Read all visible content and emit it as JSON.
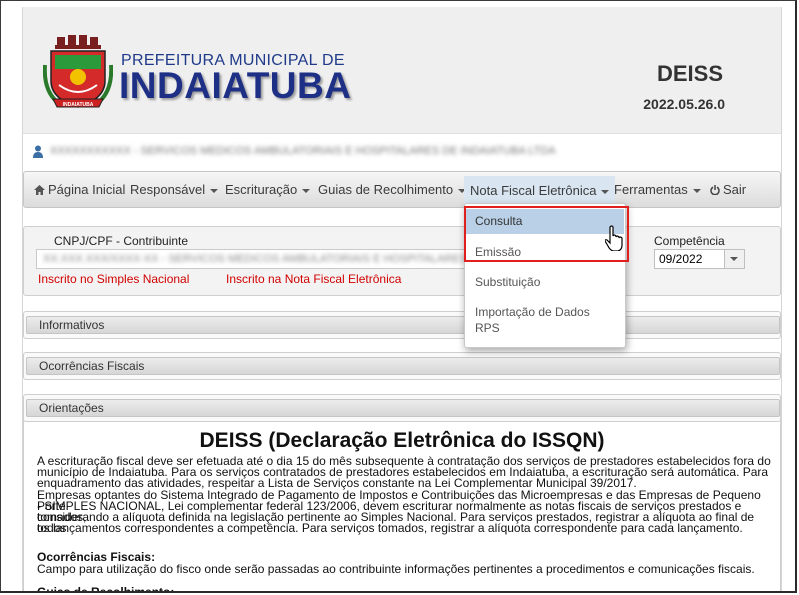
{
  "header": {
    "org_subtitle": "PREFEITURA MUNICIPAL DE",
    "org_name": "INDAIATUBA",
    "app_name": "DEISS",
    "app_version": "2022.05.26.0",
    "user_label": "XXXXXXXXXXX - SERVICOS MEDICOS AMBULATORIAIS E HOSPITALARES DE INDAIATUBA LTDA"
  },
  "nav": {
    "home": "Página Inicial",
    "responsavel": "Responsável",
    "escrituracao": "Escrituração",
    "guias": "Guias de Recolhimento",
    "nfe": "Nota Fiscal Eletrônica",
    "ferramentas": "Ferramentas",
    "sair": "Sair"
  },
  "dropdown": {
    "items": [
      "Consulta",
      "Emissão",
      "Substituição",
      "Importação de Dados",
      "RPS"
    ]
  },
  "contribuinte": {
    "label": "CNPJ/CPF - Contribuinte",
    "value": "XX.XXX.XXX/XXXX-XX - SERVICOS MEDICOS AMBULATORIAIS E HOSPITALARES",
    "simples": "Inscrito no Simples Nacional",
    "nfe": "Inscrito na Nota Fiscal Eletrônica",
    "competencia_label": "Competência",
    "competencia_value": "09/2022"
  },
  "sections": {
    "informativos": "Informativos",
    "ocorrencias": "Ocorrências Fiscais",
    "orientacoes": "Orientações"
  },
  "orientacoes": {
    "title": "DEISS (Declaração Eletrônica do ISSQN)",
    "p1_l1": "A escrituração fiscal deve ser efetuada até o dia 15 do mês subsequente à contratação dos serviços de prestadores estabelecidos fora do",
    "p1_l2": "município de Indaiatuba. Para os serviços contratados de prestadores estabelecidos em Indaiatuba, a escrituração será automática. Para",
    "p1_l3": "enquadramento das atividades, respeitar a Lista de Serviços constante na Lei Complementar Municipal 39/2017.",
    "p2_l1": "Empresas optantes do Sistema Integrado de Pagamento de Impostos e Contribuições das Microempresas e das Empresas de Pequeno Porte",
    "p2_l2": "- SIMPLES NACIONAL, Lei complementar federal 123/2006, devem escriturar normalmente as notas fiscais de serviços prestados e tomados,",
    "p2_l3": "considerando a alíquota definida na legislação pertinente ao Simples Nacional. Para serviços prestados, registrar a alíquota ao final de todos",
    "p2_l4": "os lançamentos correspondentes a competência. Para serviços tomados, registrar a alíquota correspondente para cada lançamento.",
    "ocorrencias_heading": "Ocorrências Fiscais:",
    "ocorrencias_text": "Campo para utilização do fisco onde serão passadas ao contribuinte informações pertinentes a procedimentos e comunicações fiscais.",
    "guias_heading": "Guias de Recolhimento:"
  }
}
